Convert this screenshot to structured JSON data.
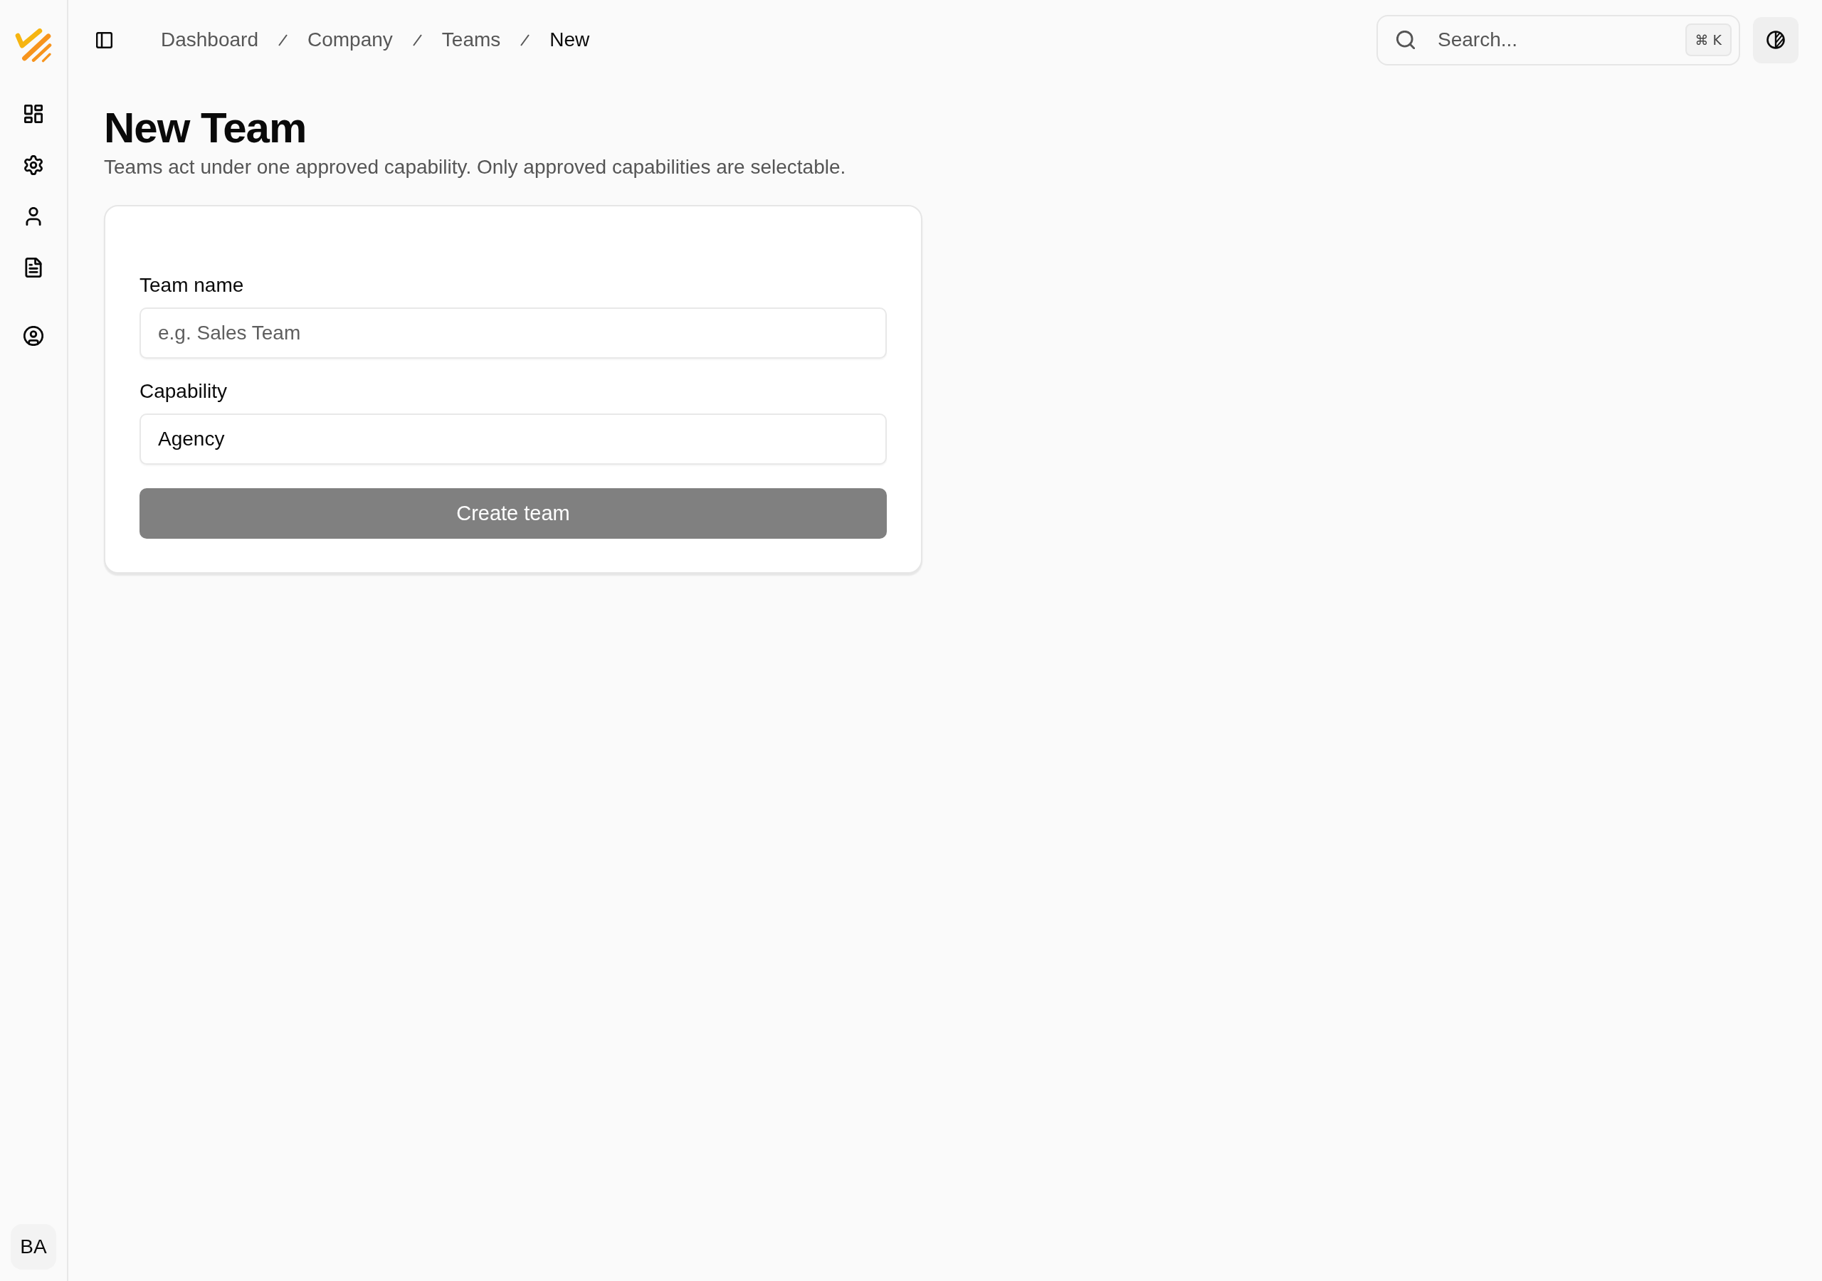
{
  "sidebar": {
    "avatar": {
      "initials": "BA"
    }
  },
  "topbar": {
    "breadcrumbs": [
      {
        "label": "Dashboard",
        "current": false
      },
      {
        "label": "Company",
        "current": false
      },
      {
        "label": "Teams",
        "current": false
      },
      {
        "label": "New",
        "current": true
      }
    ],
    "search": {
      "placeholder": "Search...",
      "shortcut": "⌘ K"
    }
  },
  "page": {
    "title": "New Team",
    "subtitle": "Teams act under one approved capability. Only approved capabilities are selectable."
  },
  "form": {
    "fields": [
      {
        "label": "Team name",
        "placeholder": "e.g. Sales Team"
      },
      {
        "label": "Capability",
        "value": "Agency"
      }
    ],
    "submit": {
      "label": "Create team",
      "disabled": true
    }
  }
}
